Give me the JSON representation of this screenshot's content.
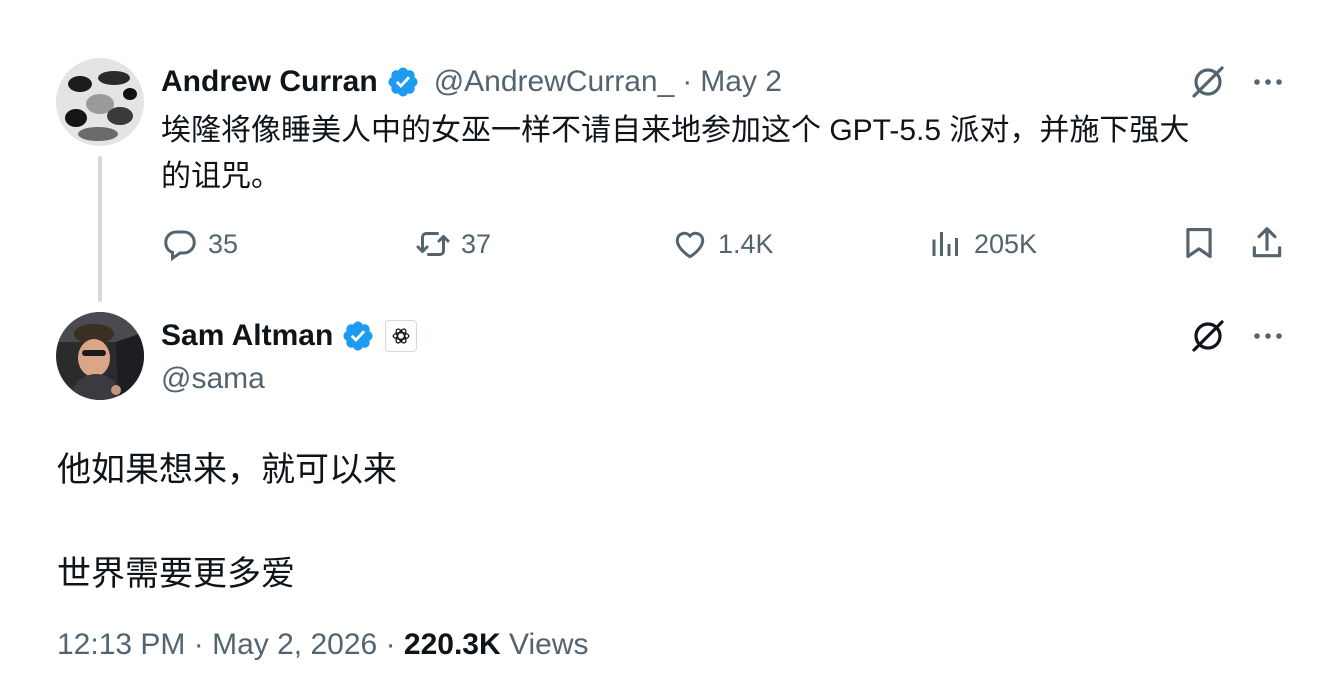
{
  "quoted_tweet": {
    "author_name": "Andrew Curran",
    "handle": "@AndrewCurran_",
    "separator": "·",
    "date": "May 2",
    "text_line1": "埃隆将像睡美人中的女巫一样不请自来地参加这个 GPT-5.5 派对，并施下强大",
    "text_line2": "的诅咒。",
    "replies": "35",
    "reposts": "37",
    "likes": "1.4K",
    "views": "205K"
  },
  "main_tweet": {
    "author_name": "Sam Altman",
    "handle": "@sama",
    "text_line1": "他如果想来，就可以来",
    "text_line2": "世界需要更多爱",
    "time": "12:13 PM",
    "separator1": "·",
    "date": "May 2, 2026",
    "separator2": "·",
    "view_count": "220.3K",
    "views_label": "Views"
  },
  "colors": {
    "verified_blue": "#1d9bf0",
    "secondary_text": "#536471",
    "primary_text": "#0f1419",
    "thread_line": "#cfd9de"
  },
  "icons": [
    "grok-icon",
    "more-icon",
    "reply-icon",
    "repost-icon",
    "like-icon",
    "views-icon",
    "bookmark-icon",
    "share-icon",
    "verified-badge-icon",
    "openai-affiliate-icon"
  ]
}
